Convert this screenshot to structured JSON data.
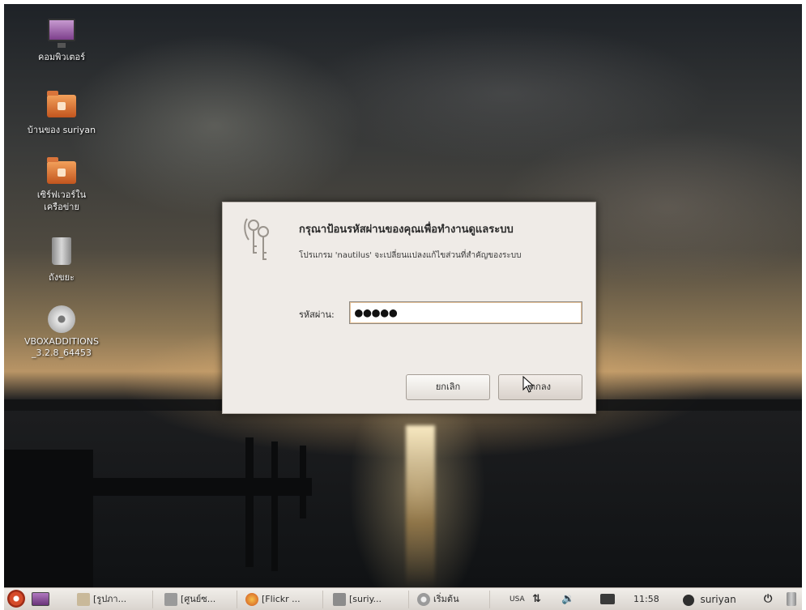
{
  "desktop": {
    "icons": [
      {
        "label": "คอมพิวเตอร์",
        "icon": "computer-icon"
      },
      {
        "label": "บ้านของ suriyan",
        "icon": "home-folder-icon"
      },
      {
        "label": "เซิร์ฟเวอร์ใน\nเครือข่าย",
        "icon": "network-folder-icon"
      },
      {
        "label": "ถังขยะ",
        "icon": "trash-icon"
      },
      {
        "label": "VBOXADDITIONS\n_3.2.8_64453",
        "icon": "disc-icon"
      }
    ]
  },
  "dialog": {
    "title": "กรุณาป้อนรหัสผ่านของคุณเพื่อทำงานดูแลระบบ",
    "message": "โปรแกรม 'nautilus' จะเปลี่ยนแปลงแก้ไขส่วนที่สำคัญของระบบ",
    "password_label": "รหัสผ่าน:",
    "password_value": "●●●●●",
    "cancel_label": "ยกเลิก",
    "ok_label": "ตกลง",
    "icon": "keys-icon"
  },
  "taskbar": {
    "tasks": [
      {
        "label": "[รูปภา...",
        "icon": "image-viewer-icon"
      },
      {
        "label": "[ศูนย์ซ...",
        "icon": "software-center-icon"
      },
      {
        "label": "[Flickr ...",
        "icon": "firefox-icon"
      },
      {
        "label": "[suriy...",
        "icon": "folder-icon"
      },
      {
        "label": "เริ่มต้น",
        "icon": "gear-icon"
      }
    ],
    "keyboard_layout": "USA",
    "clock": "11:58",
    "user": "suriyan"
  },
  "colors": {
    "dialog_bg": "#efebe7",
    "taskbar_bg": "#e5e1dc",
    "focus_ring": "#e7c39a"
  }
}
